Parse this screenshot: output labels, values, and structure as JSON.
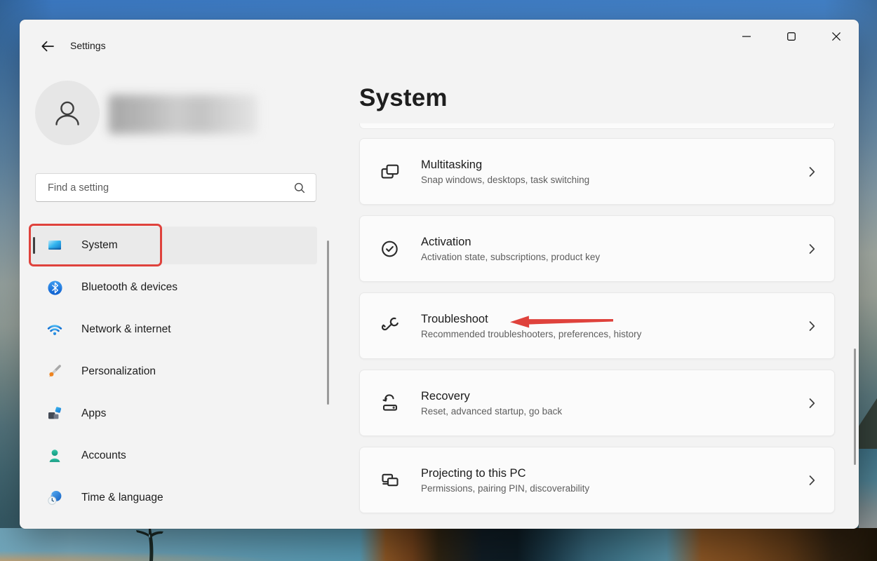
{
  "window": {
    "app_title": "Settings",
    "controls": {
      "minimize": "minimize",
      "maximize": "maximize",
      "close": "close"
    }
  },
  "sidebar": {
    "search": {
      "placeholder": "Find a setting"
    },
    "items": [
      {
        "label": "System",
        "icon": "system-icon",
        "selected": true
      },
      {
        "label": "Bluetooth & devices",
        "icon": "bluetooth-icon",
        "selected": false
      },
      {
        "label": "Network & internet",
        "icon": "network-icon",
        "selected": false
      },
      {
        "label": "Personalization",
        "icon": "personalization-icon",
        "selected": false
      },
      {
        "label": "Apps",
        "icon": "apps-icon",
        "selected": false
      },
      {
        "label": "Accounts",
        "icon": "accounts-icon",
        "selected": false
      },
      {
        "label": "Time & language",
        "icon": "time-language-icon",
        "selected": false
      }
    ]
  },
  "main": {
    "page_title": "System",
    "cards": [
      {
        "title": "Multitasking",
        "subtitle": "Snap windows, desktops, task switching",
        "icon": "multitasking-icon"
      },
      {
        "title": "Activation",
        "subtitle": "Activation state, subscriptions, product key",
        "icon": "activation-icon"
      },
      {
        "title": "Troubleshoot",
        "subtitle": "Recommended troubleshooters, preferences, history",
        "icon": "troubleshoot-icon"
      },
      {
        "title": "Recovery",
        "subtitle": "Reset, advanced startup, go back",
        "icon": "recovery-icon"
      },
      {
        "title": "Projecting to this PC",
        "subtitle": "Permissions, pairing PIN, discoverability",
        "icon": "projecting-icon"
      }
    ]
  },
  "annotations": {
    "highlight_color": "#df423c",
    "boxed_sidebar_item": "System",
    "arrow_points_to": "Troubleshoot"
  }
}
